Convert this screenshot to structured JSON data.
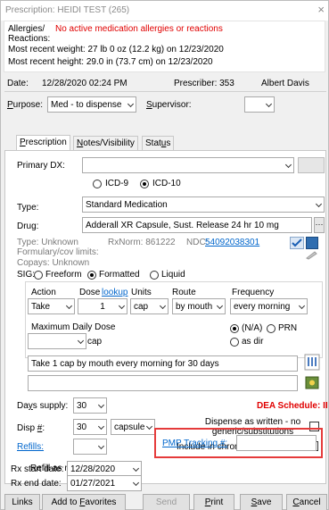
{
  "window": {
    "title": "Prescription: HEIDI TEST (265)",
    "close": "×"
  },
  "info": {
    "allergies_label": "Allergies/\nReactions:",
    "allergies_value": "No active medication allergies or reactions",
    "weight": "Most recent weight: 27 lb 0 oz (12.2 kg) on 12/23/2020",
    "height": "Most recent height: 29.0 in (73.7 cm) on 12/23/2020"
  },
  "header": {
    "date_label": "Date:",
    "date_value": "12/28/2020 02:24 PM",
    "prescriber_label": "Prescriber: 353",
    "prescriber_name": "Albert Davis",
    "purpose_label": "Purpose:",
    "purpose_value": "Med - to dispense",
    "supervisor_label": "Supervisor:",
    "supervisor_value": ""
  },
  "tabs": [
    "Prescription",
    "Notes/Visibility",
    "Status"
  ],
  "rx": {
    "primary_dx_label": "Primary DX:",
    "icd9": "ICD-9",
    "icd10": "ICD-10",
    "type_label": "Type:",
    "type_value": "Standard Medication",
    "drug_label": "Drug:",
    "drug_value": "Adderall XR Capsule, Sust. Release 24 hr 10 mg",
    "type_info": "Type:  Unknown",
    "rxnorm": "RxNorm:  861222",
    "ndc_label": "NDC:",
    "ndc_value": "54092038301",
    "formulary": "Formulary/cov limits:",
    "copays": "Copays: Unknown",
    "sig_label": "SIG:",
    "sig_freeform": "Freeform",
    "sig_formatted": "Formatted",
    "sig_liquid": "Liquid",
    "col_action": "Action",
    "col_dose": "Dose",
    "col_lookup": "lookup",
    "col_units": "Units",
    "col_route": "Route",
    "col_frequency": "Frequency",
    "action_value": "Take",
    "dose_value": "1",
    "units_value": "cap",
    "route_value": "by mouth",
    "frequency_value": "every morning",
    "max_daily_label": "Maximum Daily Dose",
    "max_daily_unit": "cap",
    "na": "(N/A)",
    "prn": "PRN",
    "as_dir": "as dir",
    "sig_text": "Take 1 cap by mouth every morning for 30 days",
    "days_supply_label": "Days supply:",
    "days_supply_value": "30",
    "dea_schedule": "DEA Schedule: II",
    "disp_label": "Disp #:",
    "disp_value": "30",
    "disp_unit": "capsule",
    "daw_label": "Dispense as written - no generic/substitutions",
    "refills_label": "Refills:",
    "refills_value": "",
    "chronic_label": "Include in chronic medication list",
    "refill_needed_label": "Refill as needed",
    "pmp_label": "PMP Tracking #:",
    "pmp_value": "",
    "start_label": "Rx start date:",
    "start_value": "12/28/2020",
    "end_label": "Rx end date:",
    "end_value": "01/27/2021"
  },
  "footer": {
    "links": "Links",
    "favorites": "Add to Favorites",
    "send": "Send",
    "print": "Print",
    "save": "Save",
    "cancel": "Cancel"
  }
}
